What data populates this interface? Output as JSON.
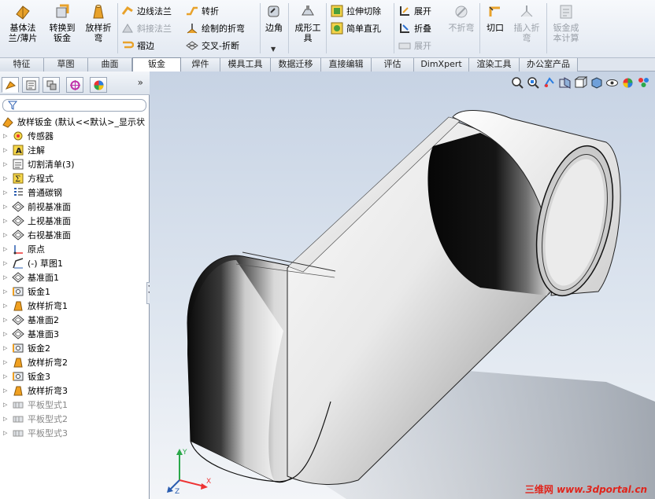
{
  "ribbon": {
    "big_buttons": [
      {
        "id": "base-flange",
        "label_1": "基体法",
        "label_2": "兰/薄片",
        "icon": "base-flange-icon"
      },
      {
        "id": "convert-to-sheetmetal",
        "label_1": "转换到",
        "label_2": "钣金",
        "icon": "convert-sheetmetal-icon"
      },
      {
        "id": "lofted-bend",
        "label_1": "放样折",
        "label_2": "弯",
        "icon": "lofted-bend-icon"
      },
      {
        "id": "corner",
        "label_1": "边角",
        "label_2": "",
        "icon": "corner-icon"
      },
      {
        "id": "forming-tool",
        "label_1": "成形工",
        "label_2": "具",
        "icon": "forming-tool-icon"
      },
      {
        "id": "no-bends",
        "label_1": "不折弯",
        "label_2": "",
        "icon": "no-bends-icon",
        "disabled": true
      },
      {
        "id": "rip",
        "label_1": "切口",
        "label_2": "",
        "icon": "rip-icon"
      },
      {
        "id": "insert-bends",
        "label_1": "插入折",
        "label_2": "弯",
        "icon": "insert-bends-icon",
        "disabled": true
      },
      {
        "id": "sheetmetal-cost",
        "label_1": "钣金成",
        "label_2": "本计算",
        "icon": "cost-icon",
        "disabled": true
      }
    ],
    "small_buttons": [
      {
        "id": "edge-flange",
        "label": "边线法兰",
        "icon": "edge-flange-icon"
      },
      {
        "id": "miter-flange",
        "label": "斜接法兰",
        "icon": "miter-flange-icon",
        "disabled": true
      },
      {
        "id": "hem",
        "label": "褶边",
        "icon": "hem-icon"
      },
      {
        "id": "jog",
        "label": "转折",
        "icon": "jog-icon"
      },
      {
        "id": "sketched-bend",
        "label": "绘制的折弯",
        "icon": "sketched-bend-icon"
      },
      {
        "id": "cross-break",
        "label": "交叉-折断",
        "icon": "cross-break-icon"
      },
      {
        "id": "extruded-cut",
        "label": "拉伸切除",
        "icon": "extruded-cut-icon"
      },
      {
        "id": "simple-hole",
        "label": "简单直孔",
        "icon": "simple-hole-icon"
      },
      {
        "id": "unfold",
        "label": "展开",
        "icon": "unfold-icon"
      },
      {
        "id": "fold",
        "label": "折叠",
        "icon": "fold-icon"
      },
      {
        "id": "flatten",
        "label": "展开",
        "icon": "flatten-icon",
        "disabled": true
      }
    ]
  },
  "tabs": [
    {
      "label": "特征"
    },
    {
      "label": "草图"
    },
    {
      "label": "曲面"
    },
    {
      "label": "钣金",
      "active": true
    },
    {
      "label": "焊件"
    },
    {
      "label": "模具工具"
    },
    {
      "label": "数据迁移"
    },
    {
      "label": "直接编辑"
    },
    {
      "label": "评估"
    },
    {
      "label": "DimXpert"
    },
    {
      "label": "渲染工具"
    },
    {
      "label": "办公室产品"
    }
  ],
  "feature_tree": {
    "root_label": "放样钣金 (默认<<默认>_显示状",
    "items": [
      {
        "label": "传感器",
        "icon": "sensor-icon"
      },
      {
        "label": "注解",
        "icon": "annotations-icon"
      },
      {
        "label": "切割清单(3)",
        "icon": "cut-list-icon"
      },
      {
        "label": "方程式",
        "icon": "equations-icon"
      },
      {
        "label": "普通碳钢",
        "icon": "material-icon"
      },
      {
        "label": "前视基准面",
        "icon": "plane-icon"
      },
      {
        "label": "上视基准面",
        "icon": "plane-icon"
      },
      {
        "label": "右视基准面",
        "icon": "plane-icon"
      },
      {
        "label": "原点",
        "icon": "origin-icon"
      },
      {
        "label": "(-) 草图1",
        "icon": "sketch-icon"
      },
      {
        "label": "基准面1",
        "icon": "plane-icon"
      },
      {
        "label": "钣金1",
        "icon": "sheetmetal-icon"
      },
      {
        "label": "放样折弯1",
        "icon": "lofted-bend-feature-icon"
      },
      {
        "label": "基准面2",
        "icon": "plane-icon"
      },
      {
        "label": "基准面3",
        "icon": "plane-icon"
      },
      {
        "label": "钣金2",
        "icon": "sheetmetal-icon"
      },
      {
        "label": "放样折弯2",
        "icon": "lofted-bend-feature-icon"
      },
      {
        "label": "钣金3",
        "icon": "sheetmetal-icon"
      },
      {
        "label": "放样折弯3",
        "icon": "lofted-bend-feature-icon"
      },
      {
        "label": "平板型式1",
        "icon": "flat-pattern-icon",
        "suppressed": true
      },
      {
        "label": "平板型式2",
        "icon": "flat-pattern-icon",
        "suppressed": true
      },
      {
        "label": "平板型式3",
        "icon": "flat-pattern-icon",
        "suppressed": true
      }
    ]
  },
  "watermark": {
    "cn": "三维网",
    "url": "www.3dportal.cn"
  },
  "colors": {
    "accent": "#f0a020",
    "tab_border": "#9ea9b9",
    "suppressed": "#888888"
  }
}
